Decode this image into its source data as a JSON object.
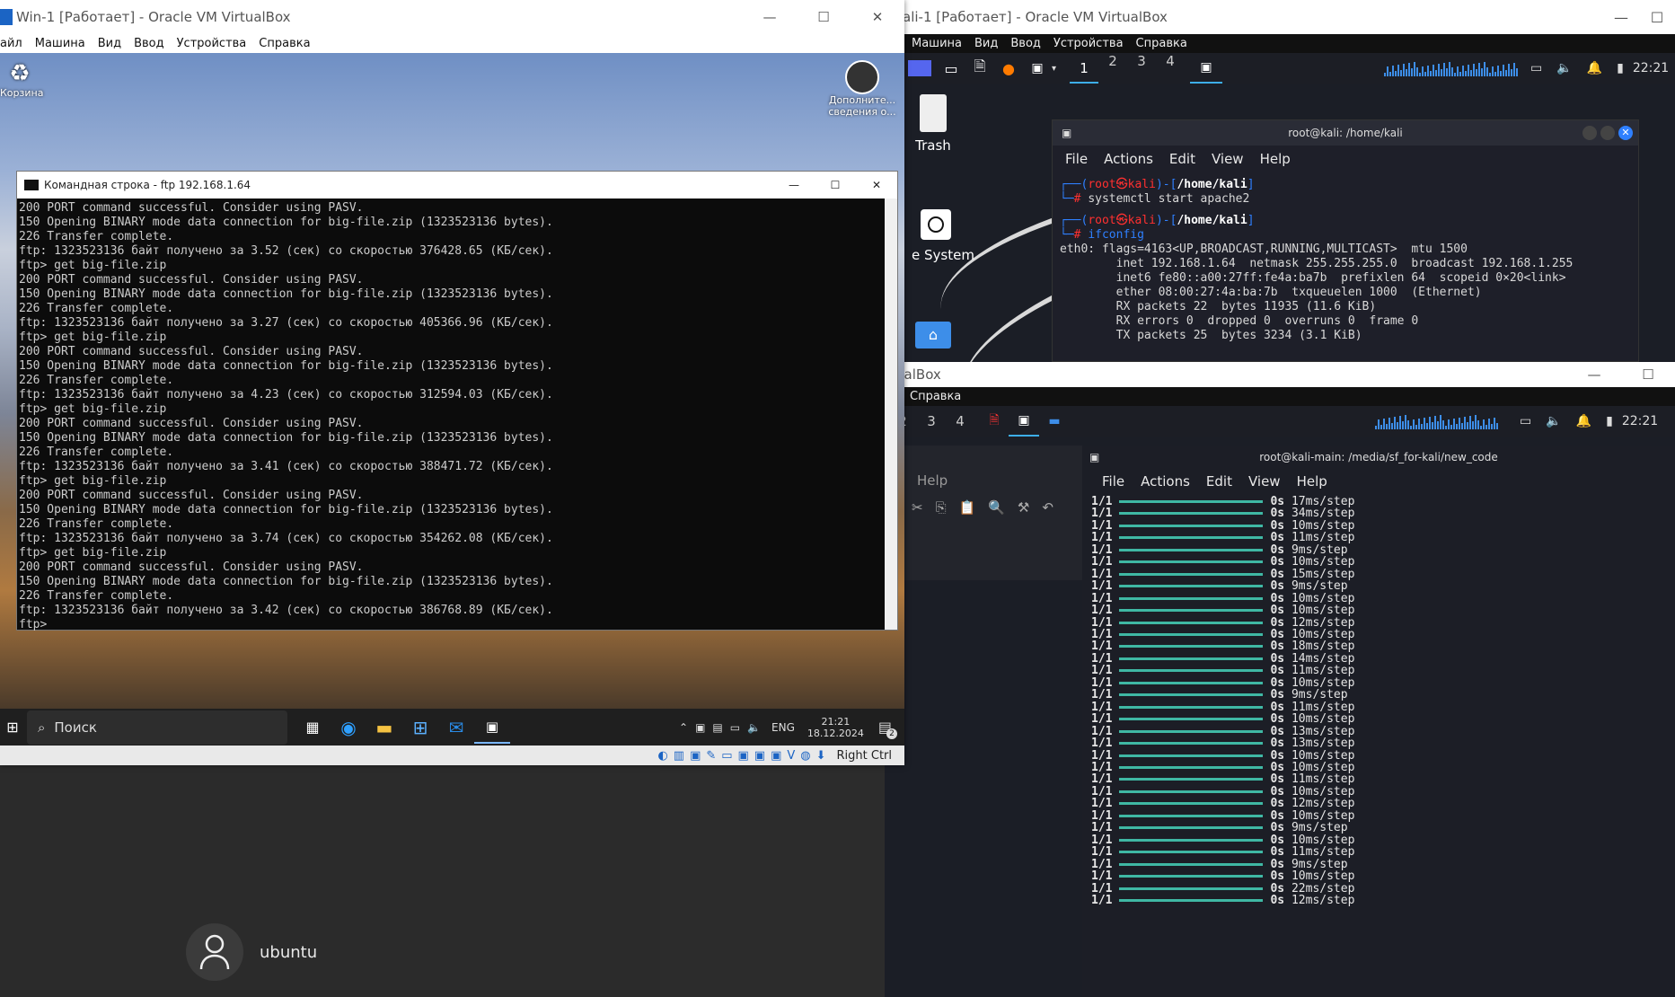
{
  "ubuntu": {
    "username": "ubuntu"
  },
  "kali_top": {
    "window_title": "ali-1 [Работает] - Oracle VM VirtualBox",
    "menu": [
      "Машина",
      "Вид",
      "Ввод",
      "Устройства",
      "Справка"
    ],
    "workspaces": [
      "1",
      "2",
      "3",
      "4"
    ],
    "clock": "22:21",
    "desktop_icons": {
      "trash": "Trash",
      "filesystem": "e System"
    },
    "terminal": {
      "title": "root@kali: /home/kali",
      "menu": [
        "File",
        "Actions",
        "Edit",
        "View",
        "Help"
      ],
      "prompt_user": "root",
      "prompt_at": "㉿",
      "prompt_host": "kali",
      "prompt_path": "/home/kali",
      "cmd1": "systemctl start apache2",
      "cmd2": "ifconfig",
      "output": [
        "eth0: flags=4163<UP,BROADCAST,RUNNING,MULTICAST>  mtu 1500",
        "        inet 192.168.1.64  netmask 255.255.255.0  broadcast 192.168.1.255",
        "        inet6 fe80::a00:27ff:fe4a:ba7b  prefixlen 64  scopeid 0×20<link>",
        "        ether 08:00:27:4a:ba:7b  txqueuelen 1000  (Ethernet)",
        "        RX packets 22  bytes 11935 (11.6 KiB)",
        "        RX errors 0  dropped 0  overruns 0  frame 0",
        "        TX packets 25  bytes 3234 (3.1 KiB)"
      ]
    }
  },
  "kali_bottom": {
    "window_title": "rtualBox",
    "menu": [
      "Справка"
    ],
    "workspaces": [
      "2",
      "3",
      "4"
    ],
    "clock": "22:21",
    "behind_menu": "Help",
    "terminal": {
      "title": "root@kali-main: /media/sf_for-kali/new_code",
      "menu": [
        "File",
        "Actions",
        "Edit",
        "View",
        "Help"
      ],
      "steps": [
        "17ms/step",
        "34ms/step",
        "10ms/step",
        "11ms/step",
        "9ms/step",
        "10ms/step",
        "15ms/step",
        "9ms/step",
        "10ms/step",
        "10ms/step",
        "12ms/step",
        "10ms/step",
        "18ms/step",
        "14ms/step",
        "11ms/step",
        "10ms/step",
        "9ms/step",
        "11ms/step",
        "10ms/step",
        "13ms/step",
        "13ms/step",
        "10ms/step",
        "10ms/step",
        "11ms/step",
        "10ms/step",
        "12ms/step",
        "10ms/step",
        "9ms/step",
        "10ms/step",
        "11ms/step",
        "9ms/step",
        "10ms/step",
        "22ms/step",
        "12ms/step"
      ],
      "step_prefix": "1/1",
      "step_time": "0s"
    }
  },
  "win": {
    "window_title": "Win-1 [Работает] - Oracle VM VirtualBox",
    "menu": [
      "айл",
      "Машина",
      "Вид",
      "Ввод",
      "Устройства",
      "Справка"
    ],
    "desktop_icons": {
      "recycle": "Корзина",
      "extra": "Дополните... сведения о..."
    },
    "cmd": {
      "title": "Командная строка - ftp  192.168.1.64",
      "lines": [
        "200 PORT command successful. Consider using PASV.",
        "150 Opening BINARY mode data connection for big-file.zip (1323523136 bytes).",
        "226 Transfer complete.",
        "ftp: 1323523136 байт получено за 3.52 (сек) со скоростью 376428.65 (КБ/сек).",
        "ftp> get big-file.zip",
        "200 PORT command successful. Consider using PASV.",
        "150 Opening BINARY mode data connection for big-file.zip (1323523136 bytes).",
        "226 Transfer complete.",
        "ftp: 1323523136 байт получено за 3.27 (сек) со скоростью 405366.96 (КБ/сек).",
        "ftp> get big-file.zip",
        "200 PORT command successful. Consider using PASV.",
        "150 Opening BINARY mode data connection for big-file.zip (1323523136 bytes).",
        "226 Transfer complete.",
        "ftp: 1323523136 байт получено за 4.23 (сек) со скоростью 312594.03 (КБ/сек).",
        "ftp> get big-file.zip",
        "200 PORT command successful. Consider using PASV.",
        "150 Opening BINARY mode data connection for big-file.zip (1323523136 bytes).",
        "226 Transfer complete.",
        "ftp: 1323523136 байт получено за 3.41 (сек) со скоростью 388471.72 (КБ/сек).",
        "ftp> get big-file.zip",
        "200 PORT command successful. Consider using PASV.",
        "150 Opening BINARY mode data connection for big-file.zip (1323523136 bytes).",
        "226 Transfer complete.",
        "ftp: 1323523136 байт получено за 3.74 (сек) со скоростью 354262.08 (КБ/сек).",
        "ftp> get big-file.zip",
        "200 PORT command successful. Consider using PASV.",
        "150 Opening BINARY mode data connection for big-file.zip (1323523136 bytes).",
        "226 Transfer complete.",
        "ftp: 1323523136 байт получено за 3.42 (сек) со скоростью 386768.89 (КБ/сек).",
        "ftp>"
      ]
    },
    "taskbar": {
      "search_placeholder": "Поиск",
      "lang": "ENG",
      "time": "21:21",
      "date": "18.12.2024",
      "notif_count": "2"
    },
    "host_key": "Right Ctrl"
  }
}
